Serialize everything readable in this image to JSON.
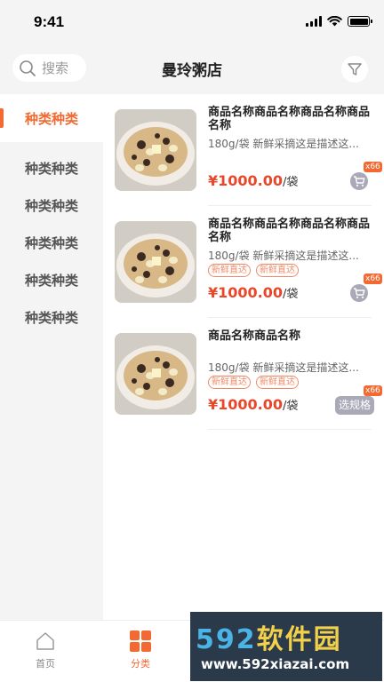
{
  "status_bar": {
    "time": "9:41"
  },
  "header": {
    "title": "曼玲粥店",
    "search_label": "搜索"
  },
  "sidebar": {
    "items": [
      {
        "label": "种类种类",
        "active": true
      },
      {
        "label": "种类种类"
      },
      {
        "label": "种类种类"
      },
      {
        "label": "种类种类"
      },
      {
        "label": "种类种类"
      },
      {
        "label": "种类种类"
      }
    ]
  },
  "goods": [
    {
      "name": "商品名称商品名称商品名称商品名称",
      "desc": "180g/袋 新鲜采摘这是描述这...",
      "tags": [],
      "price": "¥1000.00",
      "unit": "/袋",
      "badge": "x66",
      "action": "cart"
    },
    {
      "name": "商品名称商品名称商品名称商品名称",
      "desc": "180g/袋 新鲜采摘这是描述这...",
      "tags": [
        "新鲜直达",
        "新鲜直达"
      ],
      "price": "¥1000.00",
      "unit": "/袋",
      "badge": "x66",
      "action": "cart"
    },
    {
      "name": "商品名称商品名称",
      "desc": "180g/袋 新鲜采摘这是描述这...",
      "tags": [
        "新鲜直达",
        "新鲜直达"
      ],
      "price": "¥1000.00",
      "unit": "/袋",
      "badge": "x66",
      "action": "spec",
      "action_label": "选规格"
    }
  ],
  "tab_bar": {
    "tabs": [
      {
        "label": "首页",
        "icon": "home-icon"
      },
      {
        "label": "分类",
        "icon": "category-icon",
        "active": true
      }
    ]
  },
  "watermark": {
    "logo_num": "592",
    "logo_cn": "软件园",
    "url": "www.592xiazai.com"
  },
  "colors": {
    "accent": "#f26a32",
    "price": "#e8472a",
    "tag": "#f08a66"
  }
}
